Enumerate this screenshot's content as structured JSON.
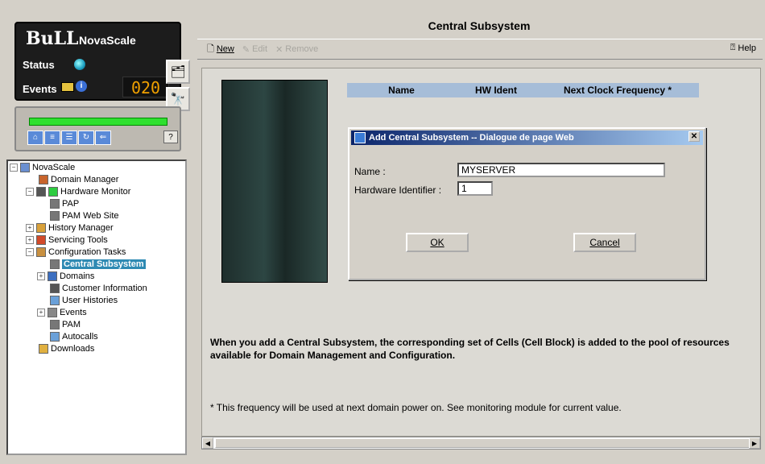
{
  "brand": {
    "logo": "BuLL",
    "product": "NovaScale",
    "status_label": "Status",
    "events_label": "Events",
    "events_count": "020"
  },
  "tree": {
    "items": [
      {
        "label": "NovaScale"
      },
      {
        "label": "Domain Manager"
      },
      {
        "label": "Hardware Monitor"
      },
      {
        "label": "PAP"
      },
      {
        "label": "PAM Web Site"
      },
      {
        "label": "History Manager"
      },
      {
        "label": "Servicing Tools"
      },
      {
        "label": "Configuration Tasks"
      },
      {
        "label": "Central Subsystem"
      },
      {
        "label": "Domains"
      },
      {
        "label": "Customer Information"
      },
      {
        "label": "User Histories"
      },
      {
        "label": "Events"
      },
      {
        "label": "PAM"
      },
      {
        "label": "Autocalls"
      },
      {
        "label": "Downloads"
      }
    ]
  },
  "page": {
    "title": "Central Subsystem"
  },
  "toolbar": {
    "new": "New",
    "edit": "Edit",
    "remove": "Remove",
    "help": "Help"
  },
  "table": {
    "columns": [
      "Name",
      "HW Ident",
      "Next Clock Frequency *"
    ]
  },
  "dialog": {
    "title": "Add Central Subsystem -- Dialogue de page Web",
    "name_label": "Name :",
    "name_value": "MYSERVER",
    "hwid_label": "Hardware Identifier :",
    "hwid_value": "1",
    "ok": "OK",
    "cancel": "Cancel"
  },
  "info": "When you add a Central Subsystem, the corresponding set of Cells (Cell Block) is added to the pool of resources available for Domain Management and Configuration.",
  "note": "* This frequency will be used at next domain power on. See monitoring module for current value."
}
